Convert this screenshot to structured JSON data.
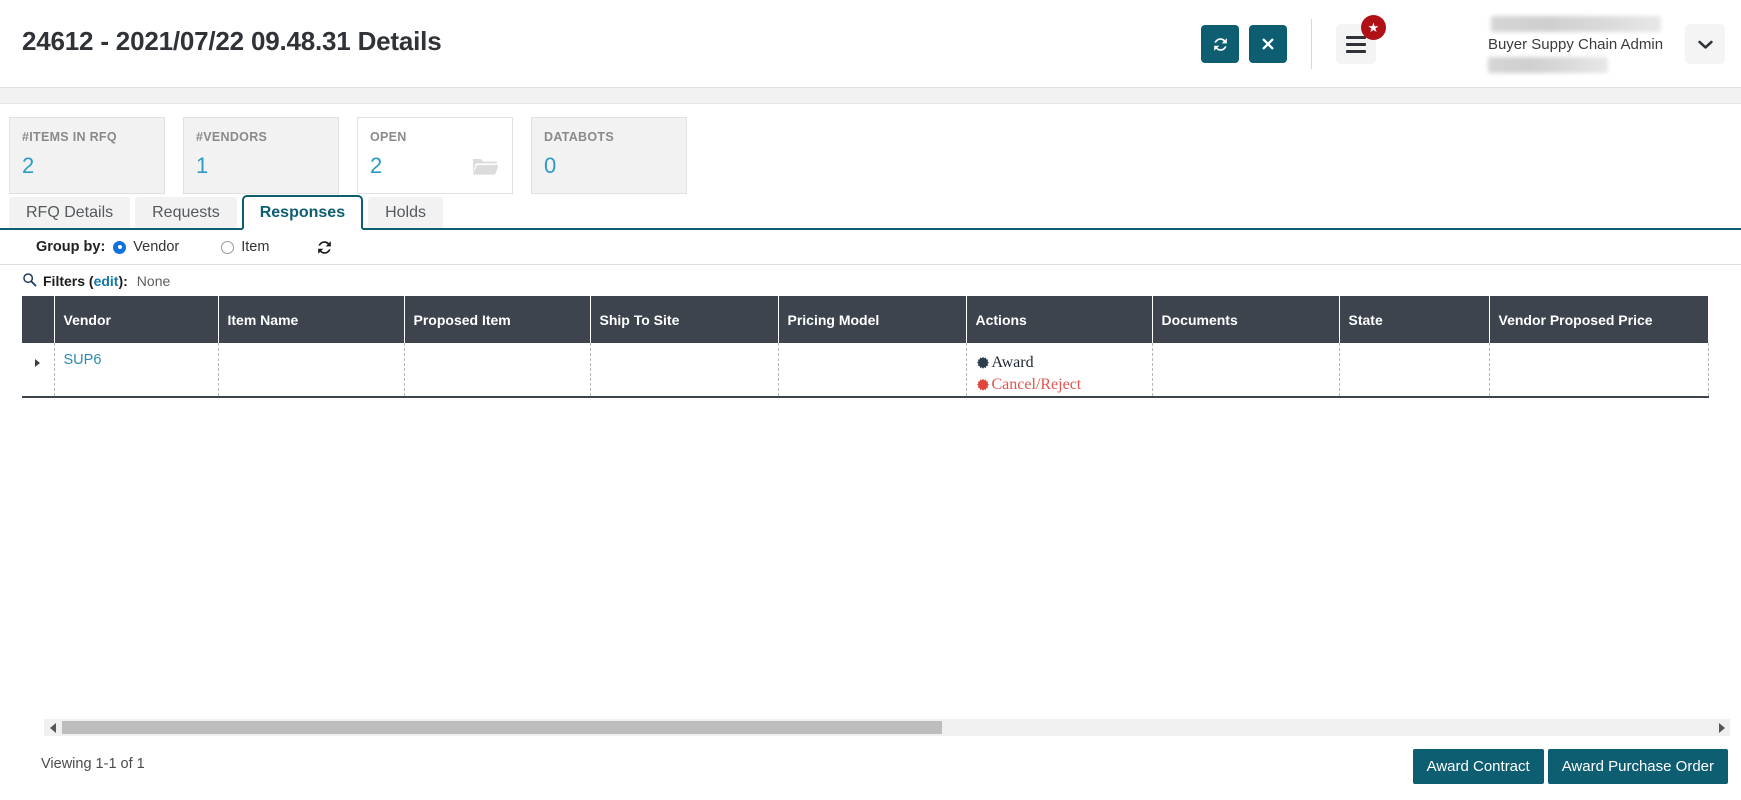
{
  "header": {
    "title": "24612 - 2021/07/22 09.48.31 Details",
    "refresh_button": "refresh-icon",
    "close_button": "close-icon",
    "menu_button": "hamburger-icon",
    "menu_badge": "★",
    "user_name": "Buyer Suppy Chain Admin",
    "user_dropdown": "chevron-down-icon"
  },
  "kpis": [
    {
      "label": "#ITEMS IN RFQ",
      "value": "2",
      "icon": "",
      "highlight": false
    },
    {
      "label": "#VENDORS",
      "value": "1",
      "icon": "",
      "highlight": false
    },
    {
      "label": "OPEN",
      "value": "2",
      "icon": "folder-icon",
      "highlight": true
    },
    {
      "label": "DATABOTS",
      "value": "0",
      "icon": "",
      "highlight": false
    }
  ],
  "tabs": [
    {
      "label": "RFQ Details",
      "active": false
    },
    {
      "label": "Requests",
      "active": false
    },
    {
      "label": "Responses",
      "active": true
    },
    {
      "label": "Holds",
      "active": false
    }
  ],
  "groupby": {
    "label": "Group by:",
    "options": [
      {
        "label": "Vendor",
        "selected": true
      },
      {
        "label": "Item",
        "selected": false
      }
    ],
    "refresh_icon": "refresh-icon"
  },
  "filters": {
    "icon": "search-icon",
    "label": "Filters (",
    "edit_link": "edit",
    "label_end": "):",
    "value": "None"
  },
  "table": {
    "columns": [
      "Vendor",
      "Item Name",
      "Proposed Item",
      "Ship To Site",
      "Pricing Model",
      "Actions",
      "Documents",
      "State",
      "Vendor Proposed Price"
    ],
    "rows": [
      {
        "vendor": "SUP6",
        "item_name": "",
        "proposed_item": "",
        "ship_to_site": "",
        "pricing_model": "",
        "actions": [
          {
            "label": "Award",
            "style": "award"
          },
          {
            "label": "Cancel/Reject",
            "style": "cancel"
          }
        ],
        "documents": "",
        "state": "",
        "vendor_proposed_price": ""
      }
    ]
  },
  "footer": {
    "viewing": "Viewing 1-1 of 1",
    "award_contract": "Award Contract",
    "award_purchase_order": "Award Purchase Order"
  },
  "colors": {
    "teal": "#0e5e72",
    "header_dark": "#3d444d",
    "link": "#2a8bb0",
    "kpi_value": "#2e9bc4",
    "badge_red": "#b01116",
    "cancel_red": "#e0554e",
    "radio_blue": "#1170e0"
  }
}
